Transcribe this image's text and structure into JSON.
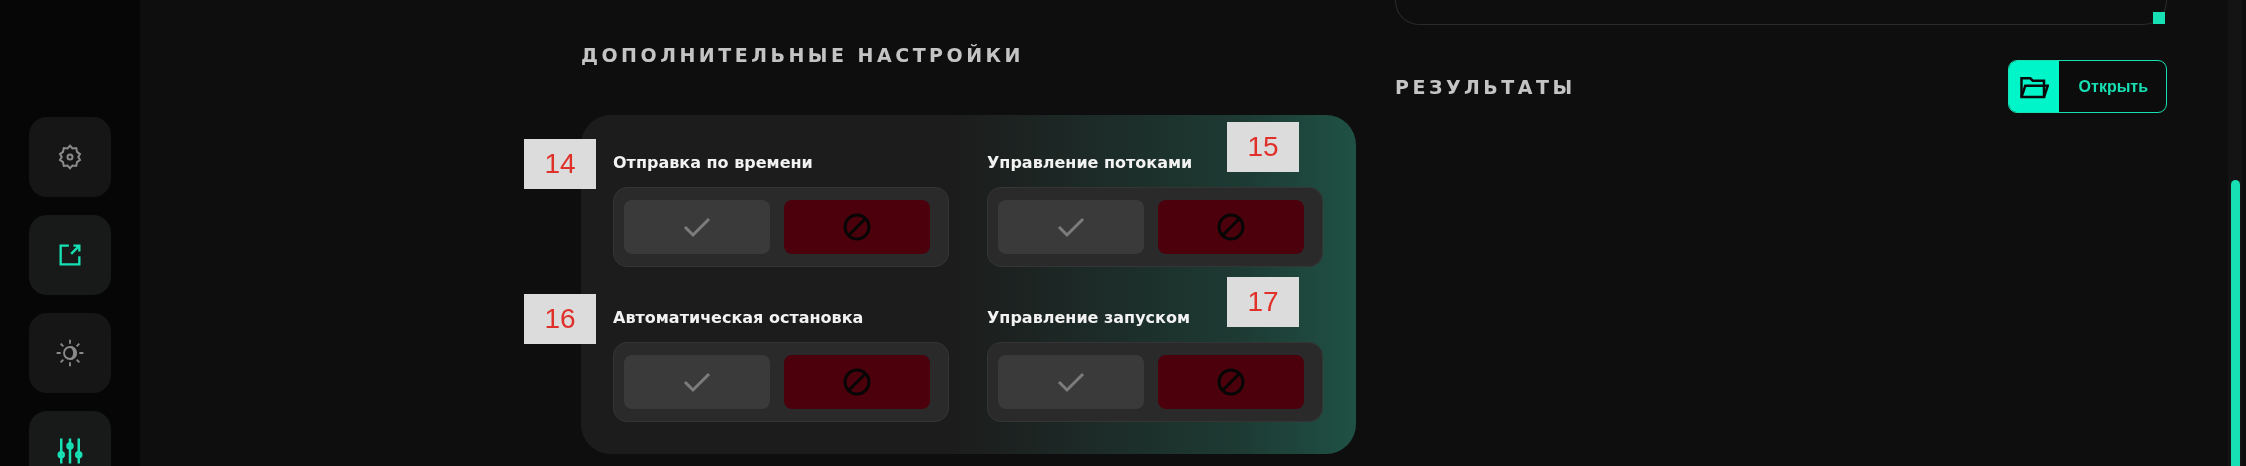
{
  "sidebar": {
    "items": [
      {
        "kind": "gear",
        "selected": false
      },
      {
        "kind": "external-link",
        "selected": true
      },
      {
        "kind": "sun-moon",
        "selected": false
      },
      {
        "kind": "sliders",
        "selected": true
      }
    ]
  },
  "additional_settings": {
    "title": "ДОПОЛНИТЕЛЬНЫЕ НАСТРОЙКИ",
    "settings": [
      {
        "label": "Отправка по времени",
        "callout": "14",
        "options": [
          {
            "kind": "check",
            "selected": false
          },
          {
            "kind": "block",
            "selected": true
          }
        ]
      },
      {
        "label": "Управление потоками",
        "callout": "15",
        "options": [
          {
            "kind": "check",
            "selected": false
          },
          {
            "kind": "block",
            "selected": true
          }
        ]
      },
      {
        "label": "Автоматическая остановка",
        "callout": "16",
        "options": [
          {
            "kind": "check",
            "selected": false
          },
          {
            "kind": "block",
            "selected": true
          }
        ]
      },
      {
        "label": "Управление запуском",
        "callout": "17",
        "options": [
          {
            "kind": "check",
            "selected": false
          },
          {
            "kind": "block",
            "selected": true
          }
        ]
      }
    ]
  },
  "results": {
    "title": "РЕЗУЛЬТАТЫ",
    "open_button": {
      "label": "Открыть"
    }
  }
}
